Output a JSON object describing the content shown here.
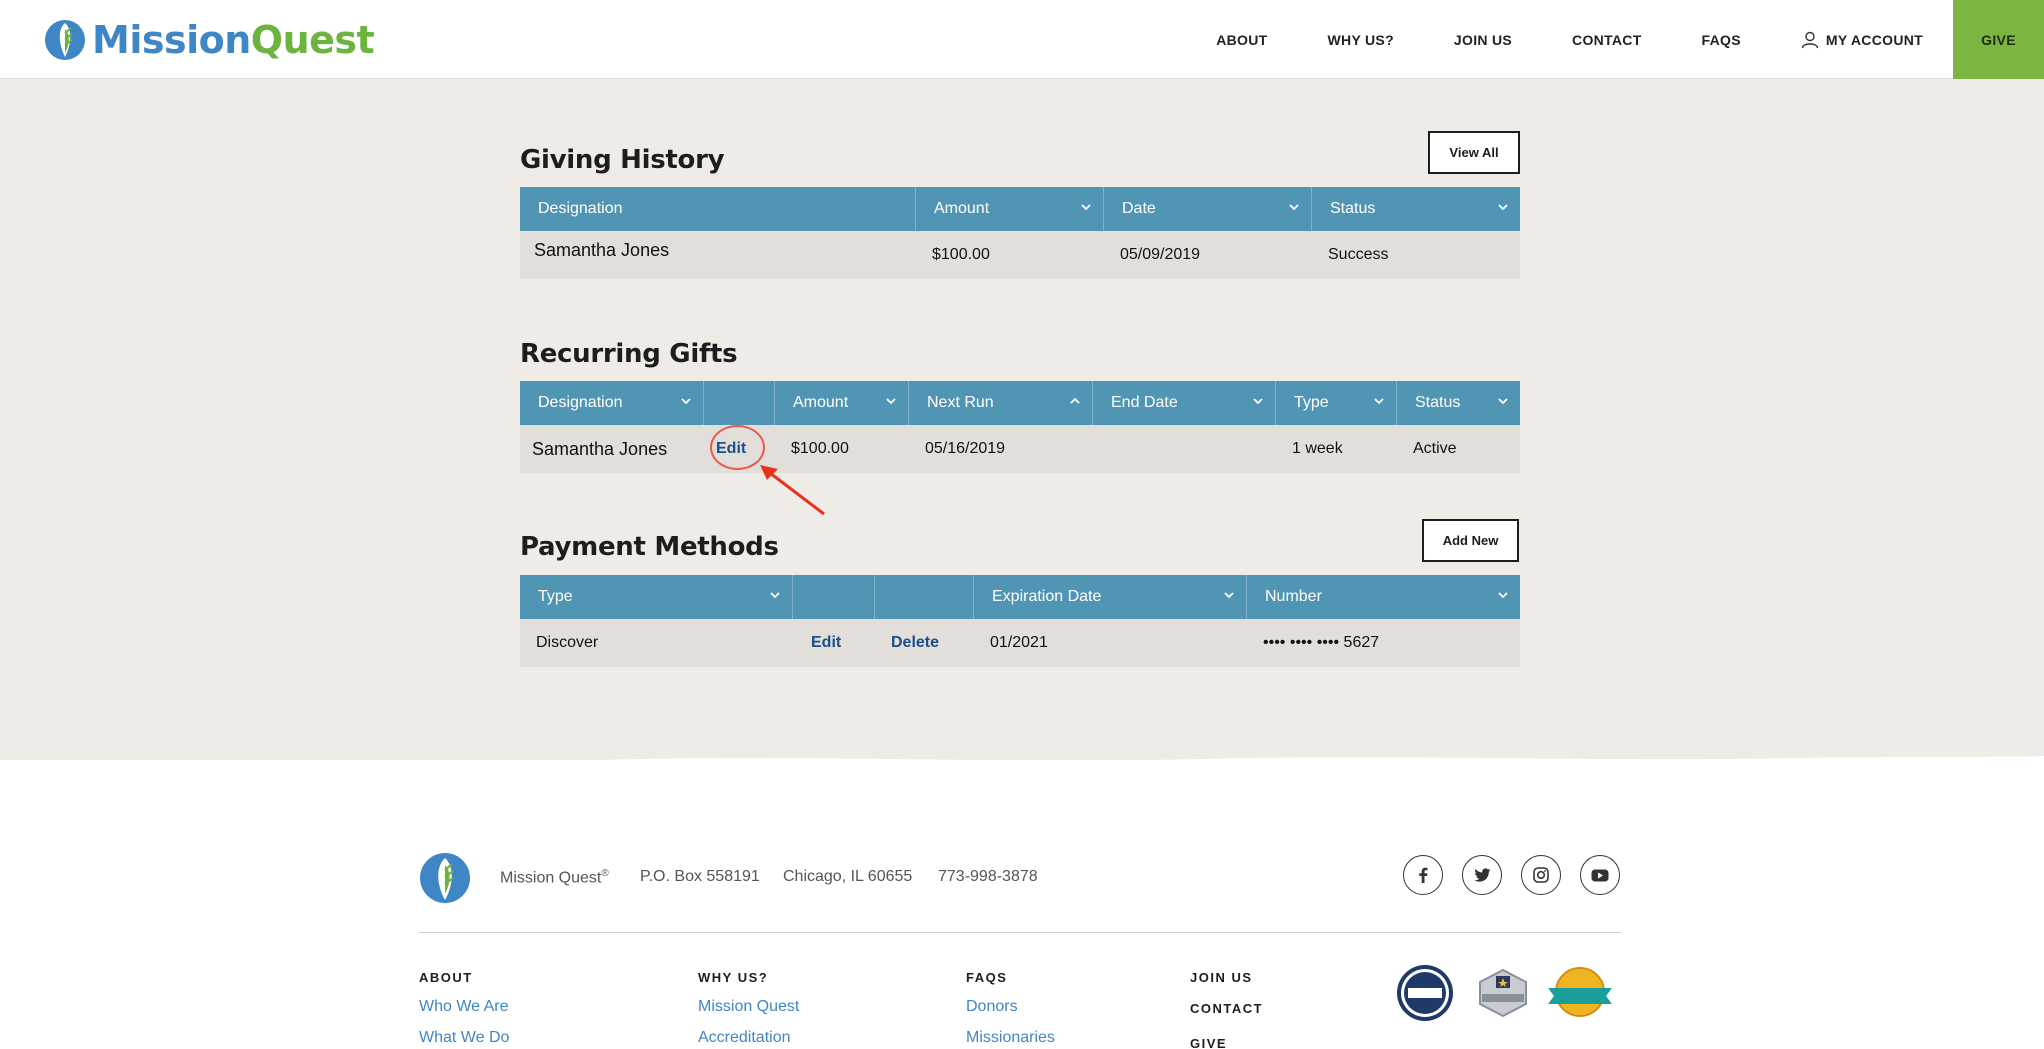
{
  "header": {
    "logo_mission": "Mission",
    "logo_quest": "Quest",
    "nav": [
      {
        "label": "ABOUT"
      },
      {
        "label": "WHY US?"
      },
      {
        "label": "JOIN US"
      },
      {
        "label": "CONTACT"
      },
      {
        "label": "FAQS"
      },
      {
        "label": "MY ACCOUNT"
      },
      {
        "label": "GIVE"
      }
    ]
  },
  "giving_history": {
    "title": "Giving History",
    "view_all_label": "View All",
    "columns": [
      "Designation",
      "Amount",
      "Date",
      "Status"
    ],
    "rows": [
      {
        "designation": "Samantha Jones",
        "amount": "$100.00",
        "date": "05/09/2019",
        "status": "Success"
      }
    ]
  },
  "recurring_gifts": {
    "title": "Recurring Gifts",
    "columns": [
      "Designation",
      "",
      "Amount",
      "Next Run",
      "End Date",
      "Type",
      "Status"
    ],
    "rows": [
      {
        "designation": "Samantha Jones",
        "edit_label": "Edit",
        "amount": "$100.00",
        "next_run": "05/16/2019",
        "end_date": "",
        "type": "1 week",
        "status": "Active"
      }
    ]
  },
  "payment_methods": {
    "title": "Payment Methods",
    "add_new_label": "Add New",
    "columns": [
      "Type",
      "",
      "",
      "Expiration Date",
      "Number"
    ],
    "rows": [
      {
        "type": "Discover",
        "edit_label": "Edit",
        "delete_label": "Delete",
        "expiration": "01/2021",
        "number": "•••• •••• •••• 5627"
      }
    ]
  },
  "footer": {
    "org_name": "Mission Quest",
    "registered": "®",
    "po_box": "P.O. Box 558191",
    "city": "Chicago, IL 60655",
    "phone": "773-998-3878",
    "social": [
      "facebook-icon",
      "twitter-icon",
      "instagram-icon",
      "youtube-icon"
    ],
    "columns": [
      {
        "heading": "ABOUT",
        "links": [
          "Who We Are",
          "What We Do"
        ]
      },
      {
        "heading": "WHY US?",
        "links": [
          "Mission Quest",
          "Accreditation"
        ]
      },
      {
        "heading": "FAQS",
        "links": [
          "Donors",
          "Missionaries"
        ]
      }
    ],
    "extra_headings": [
      "JOIN US",
      "CONTACT",
      "GIVE"
    ]
  },
  "colors": {
    "accent_blue": "#3f86c7",
    "accent_green": "#7ab640",
    "table_header": "#5195b5",
    "annotation_red": "#e85a47"
  }
}
